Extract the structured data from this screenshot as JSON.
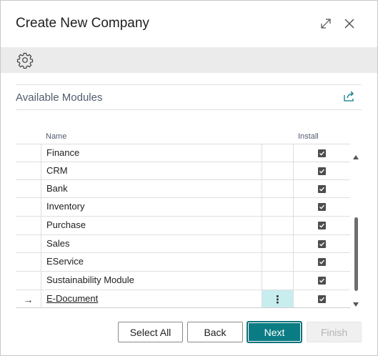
{
  "dialog": {
    "title": "Create New Company",
    "expand_icon": "expand-icon",
    "close_icon": "close-icon"
  },
  "actionbar": {
    "settings_icon": "gear-icon"
  },
  "section": {
    "title": "Available Modules",
    "share_icon": "share-icon"
  },
  "columns": {
    "name": "Name",
    "install": "Install"
  },
  "rows": [
    {
      "name": "Finance",
      "install": true
    },
    {
      "name": "CRM",
      "install": true
    },
    {
      "name": "Bank",
      "install": true
    },
    {
      "name": "Inventory",
      "install": true
    },
    {
      "name": "Purchase",
      "install": true
    },
    {
      "name": "Sales",
      "install": true
    },
    {
      "name": "EService",
      "install": true
    },
    {
      "name": "Sustainability Module",
      "install": true
    },
    {
      "name": "E-Document",
      "install": true,
      "active": true,
      "row_arrow": "→",
      "menu": "⋮"
    }
  ],
  "buttons": {
    "select_all": "Select All",
    "back": "Back",
    "next": "Next",
    "finish": "Finish"
  },
  "colors": {
    "primary": "#0c7c84",
    "active_cell": "#c8edef"
  }
}
